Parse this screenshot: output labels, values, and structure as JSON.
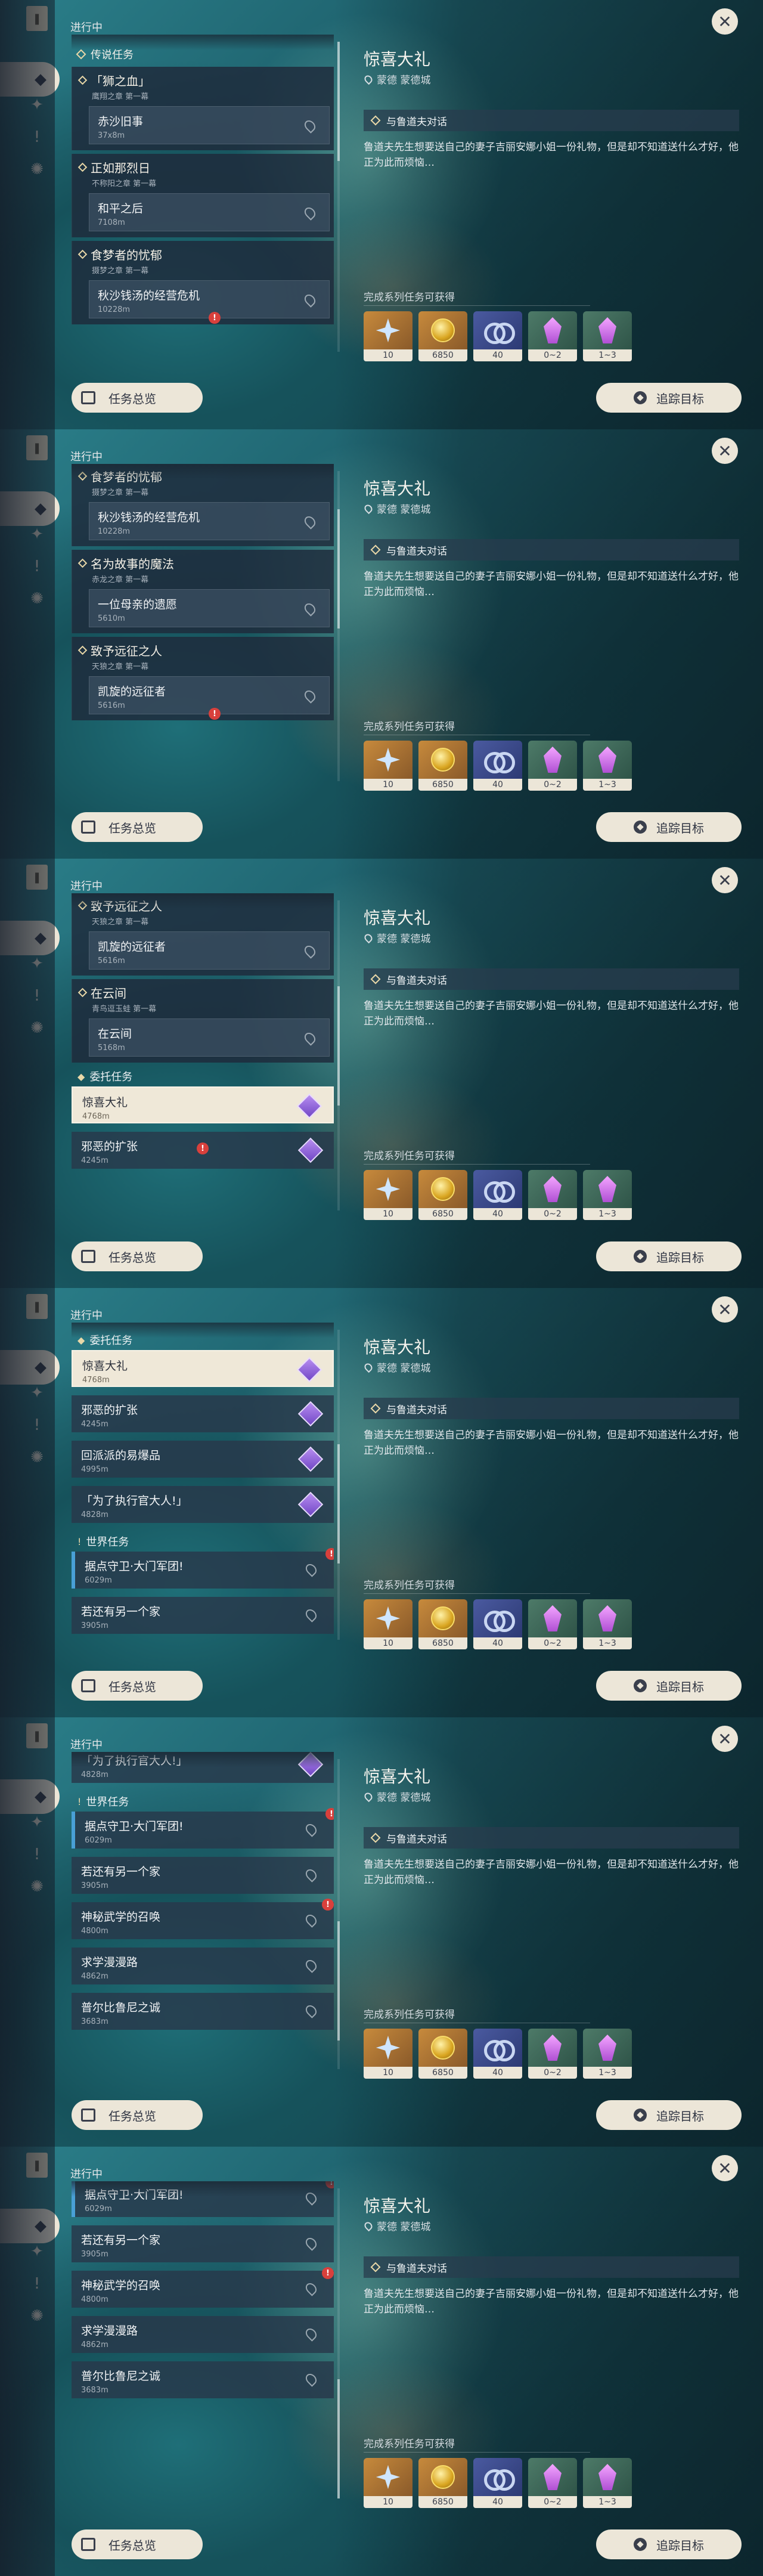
{
  "frames": [
    {
      "scroll": 0.0
    },
    {
      "scroll": 0.2
    },
    {
      "scroll": 0.45
    },
    {
      "scroll": 0.6
    },
    {
      "scroll": 0.85
    },
    {
      "scroll": 1.0
    }
  ],
  "sidebar": {
    "icons": [
      "quest-book-icon",
      "archon-quest-icon",
      "story-quest-icon",
      "commission-icon",
      "world-quest-icon"
    ]
  },
  "status_label": "进行中",
  "sections": {
    "legend": "传说任务",
    "commission": "委托任务",
    "world": "世界任务"
  },
  "chapters": [
    {
      "title": "「狮之血」",
      "sub": "鹰翔之章 第一幕",
      "quest": "赤沙旧事",
      "dist": "37x8m"
    },
    {
      "title": "正如那烈日",
      "sub": "不称阳之章 第一幕",
      "quest": "和平之后",
      "dist": "7108m"
    },
    {
      "title": "食梦者的忧郁",
      "sub": "摄梦之章 第一幕",
      "quest": "秋沙钱汤的经营危机",
      "dist": "10228m"
    },
    {
      "title": "名为故事的魔法",
      "sub": "赤龙之章 第一幕",
      "quest": "一位母亲的遗愿",
      "dist": "5610m"
    },
    {
      "title": "致予远征之人",
      "sub": "天狼之章 第一幕",
      "quest": "凯旋的远征者",
      "dist": "5616m"
    },
    {
      "title": "在云间",
      "sub": "青鸟逗玉蛙 第一幕",
      "quest": "在云间",
      "dist": "5168m"
    }
  ],
  "commissions": [
    {
      "name": "惊喜大礼",
      "dist": "4768m"
    },
    {
      "name": "邪恶的扩张",
      "dist": "4245m"
    },
    {
      "name": "回派派的易爆品",
      "dist": "4995m"
    },
    {
      "name": "「为了执行官大人!」",
      "dist": "4828m"
    }
  ],
  "world_quests": [
    {
      "name": "据点守卫·大门军团!",
      "dist": "6029m"
    },
    {
      "name": "若还有另一个家",
      "dist": "3905m"
    },
    {
      "name": "神秘武学的召唤",
      "dist": "4800m"
    },
    {
      "name": "求学漫漫路",
      "dist": "4862m"
    },
    {
      "name": "普尔比鲁尼之诚",
      "dist": "3683m"
    }
  ],
  "detail": {
    "title": "惊喜大礼",
    "location": "蒙德  蒙德城",
    "objective": "与鲁道夫对话",
    "description": "鲁道夫先生想要送自己的妻子吉丽安娜小姐一份礼物，但是却不知道送什么才好，他正为此而烦恼…",
    "rewards_label": "完成系列任务可获得",
    "rewards": [
      {
        "kind": "primogem-icon",
        "count": "10",
        "color": "gold"
      },
      {
        "kind": "mora-icon",
        "count": "6850",
        "color": "gold"
      },
      {
        "kind": "companionship-exp-icon",
        "count": "40",
        "color": "blue"
      },
      {
        "kind": "enhancement-ore-icon",
        "count": "0~2",
        "color": "green"
      },
      {
        "kind": "crystal-icon",
        "count": "1~3",
        "color": "green"
      }
    ]
  },
  "buttons": {
    "overview": "任务总览",
    "track": "追踪目标"
  }
}
